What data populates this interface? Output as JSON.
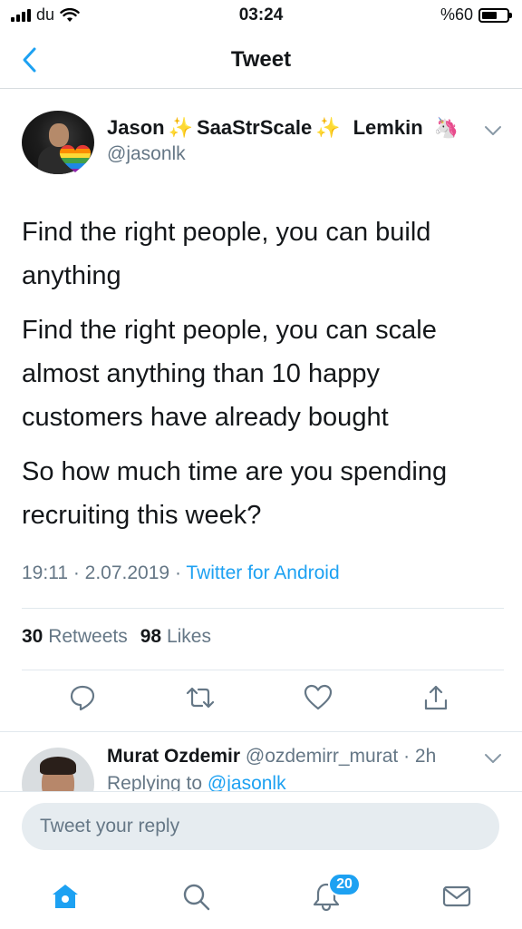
{
  "status_bar": {
    "carrier": "du",
    "time": "03:24",
    "battery_text": "%60",
    "battery_level": 0.6
  },
  "nav": {
    "title": "Tweet"
  },
  "tweet": {
    "author": {
      "first": "Jason",
      "middle": "SaaStrScale",
      "last": "Lemkin",
      "handle": "@jasonlk"
    },
    "paragraphs": [
      "Find the right people, you can build anything",
      "Find the right people, you can scale almost anything than 10 happy customers have already bought",
      "So how much time are you spending recruiting this week?"
    ],
    "time": "19:11",
    "date": "2.07.2019",
    "source": "Twitter for Android",
    "retweets_count": "30",
    "retweets_label": "Retweets",
    "likes_count": "98",
    "likes_label": "Likes"
  },
  "reply_preview": {
    "name": "Murat Ozdemir",
    "handle": "@ozdemirr_murat",
    "age": "2h",
    "replying_label": "Replying to",
    "replying_to": "@jasonlk"
  },
  "reply_box": {
    "placeholder": "Tweet your reply"
  },
  "tab_bar": {
    "notifications_badge": "20"
  },
  "colors": {
    "accent": "#1da1f2",
    "secondary_text": "#657786",
    "input_bg": "#e6ecf0"
  }
}
